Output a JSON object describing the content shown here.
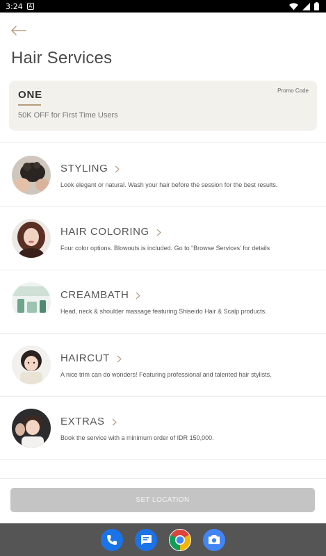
{
  "status": {
    "time": "3:24"
  },
  "header": {
    "title": "Hair Services"
  },
  "promo": {
    "code": "ONE",
    "label": "Promo Code",
    "description": "50K OFF for First Time Users"
  },
  "services": [
    {
      "name": "STYLING",
      "description": "Look elegant or natural. Wash your hair before the session for the best results."
    },
    {
      "name": "HAIR COLORING",
      "description": "Four color options. Blowouts is included. Go to “Browse Services’ for details"
    },
    {
      "name": "CREAMBATH",
      "description": "Head, neck & shoulder massage featuring Shiseido Hair & Scalp products."
    },
    {
      "name": "HAIRCUT",
      "description": "A nice trim can do wonders! Featuring professional and talented hair stylists."
    },
    {
      "name": "EXTRAS",
      "description": "Book the service with a minimum order of IDR 150,000."
    }
  ],
  "cta": {
    "label": "SET LOCATION"
  },
  "colors": {
    "accent": "#b59d7d",
    "promo_bg": "#f2f1ec",
    "button_disabled": "#c4c4c4"
  },
  "dock": [
    "phone-icon",
    "messages-icon",
    "chrome-icon",
    "camera-icon"
  ]
}
